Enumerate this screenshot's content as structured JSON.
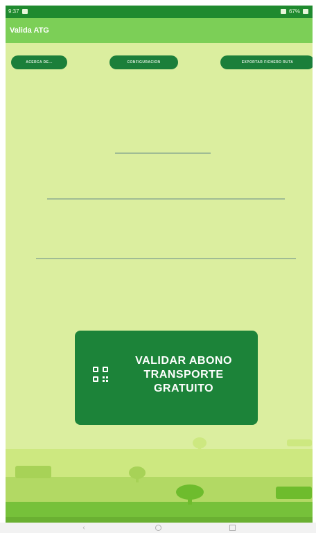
{
  "status_bar": {
    "time": "9:37",
    "right_text": "67%"
  },
  "app_bar": {
    "title": "Valida ATG"
  },
  "actions": {
    "about_label": "ACERCA DE...",
    "config_label": "CONFIGURACION",
    "export_label": "EXPORTAR FICHERO RUTA"
  },
  "fields": [
    {
      "value": ""
    },
    {
      "value": ""
    },
    {
      "value": ""
    }
  ],
  "main_button": {
    "label": "VALIDAR ABONO\nTRANSPORTE\nGRATUITO",
    "icon": "qr-code-scan-icon"
  },
  "colors": {
    "primary": "#1c8339",
    "appbar": "#7ccf57",
    "background": "#dbee9f"
  },
  "nav_icons": [
    "back-icon",
    "home-icon",
    "recent-apps-icon"
  ]
}
